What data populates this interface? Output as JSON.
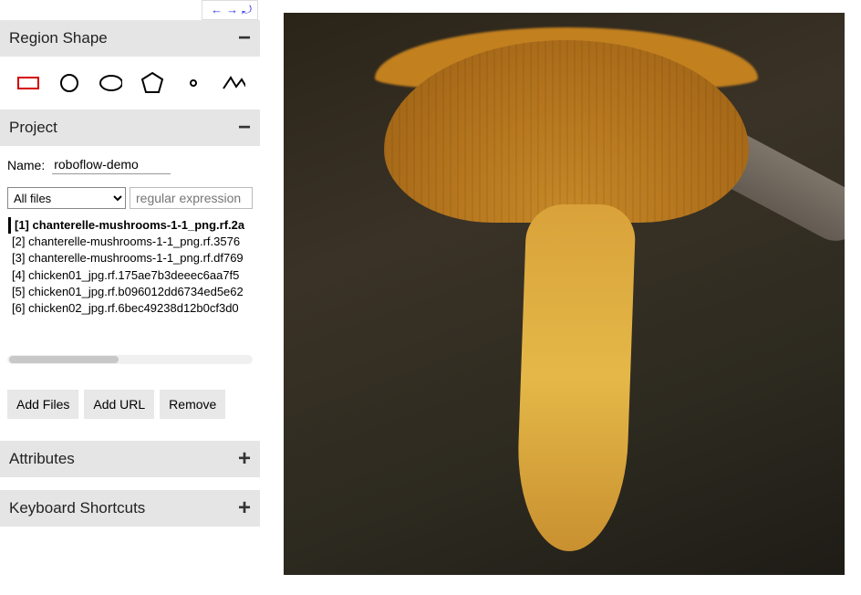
{
  "nav": {
    "prev": "←",
    "next": "→",
    "more": "⤾"
  },
  "panels": {
    "region_shape": {
      "title": "Region Shape",
      "toggle": "−"
    },
    "project": {
      "title": "Project",
      "toggle": "−"
    },
    "attributes": {
      "title": "Attributes",
      "toggle": "+"
    },
    "shortcuts": {
      "title": "Keyboard Shortcuts",
      "toggle": "+"
    }
  },
  "shapes": {
    "rect": "rect",
    "circle": "circle",
    "ellipse": "ellipse",
    "polygon": "polygon",
    "point": "point",
    "polyline": "polyline"
  },
  "project": {
    "name_label": "Name:",
    "name_value": "roboflow-demo",
    "filter_selected": "All files",
    "regex_placeholder": "regular expression",
    "files": [
      {
        "idx": "[1]",
        "name": "chanterelle-mushrooms-1-1_png.rf.2a",
        "selected": true
      },
      {
        "idx": "[2]",
        "name": "chanterelle-mushrooms-1-1_png.rf.3576",
        "selected": false
      },
      {
        "idx": "[3]",
        "name": "chanterelle-mushrooms-1-1_png.rf.df769",
        "selected": false
      },
      {
        "idx": "[4]",
        "name": "chicken01_jpg.rf.175ae7b3deeec6aa7f5",
        "selected": false
      },
      {
        "idx": "[5]",
        "name": "chicken01_jpg.rf.b096012dd6734ed5e62",
        "selected": false
      },
      {
        "idx": "[6]",
        "name": "chicken02_jpg.rf.6bec49238d12b0cf3d0",
        "selected": false
      }
    ],
    "buttons": {
      "add_files": "Add Files",
      "add_url": "Add URL",
      "remove": "Remove"
    }
  }
}
